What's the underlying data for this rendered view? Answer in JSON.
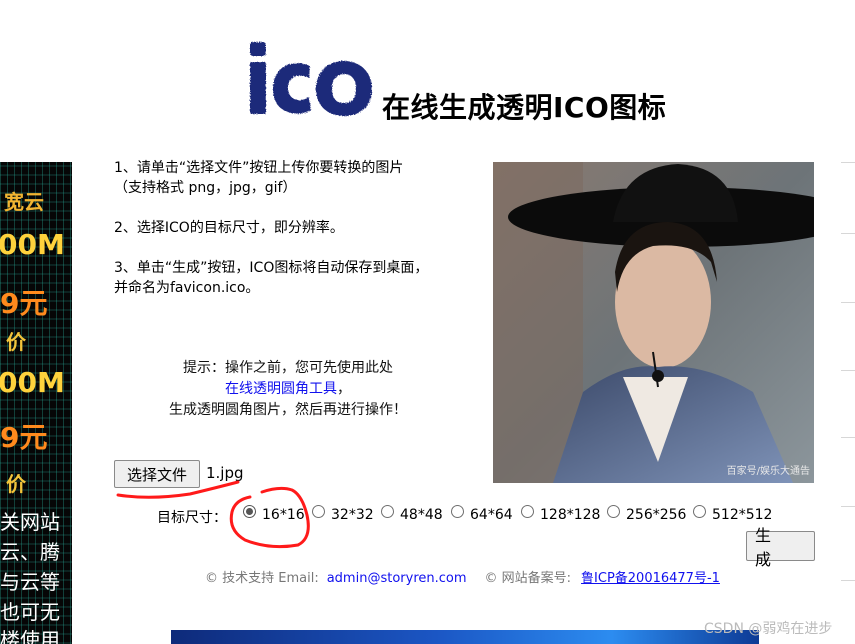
{
  "header": {
    "logo_text": "ico",
    "title": "在线生成透明ICO图标"
  },
  "ad": {
    "lines": [
      "宽云",
      "00M",
      "9元",
      "价",
      "00M",
      "9元",
      "价",
      "关网站",
      "云、腾",
      "与云等",
      "也可无",
      "楼使用"
    ]
  },
  "steps": {
    "step1_line1": "1、请单击“选择文件”按钮上传你要转换的图片",
    "step1_line2": "（支持格式 png，jpg，gif）",
    "step2": "2、选择ICO的目标尺寸，即分辨率。",
    "step3_line1": "3、单击“生成”按钮，ICO图标将自动保存到桌面，",
    "step3_line2": "并命名为favicon.ico。"
  },
  "tip": {
    "line1": "提示：操作之前，您可先使用此处",
    "link": "在线透明圆角工具",
    "link_suffix": "，",
    "line3": "生成透明圆角图片，然后再进行操作！"
  },
  "preview": {
    "caption": "百家号/娱乐大通告"
  },
  "form": {
    "file_button": "选择文件",
    "file_name": "1.jpg",
    "size_label": "目标尺寸：",
    "sizes": [
      "16*16",
      "32*32",
      "48*48",
      "64*64",
      "128*128",
      "256*256",
      "512*512"
    ],
    "selected_size": "16*16",
    "generate_button": "生 成"
  },
  "footer": {
    "support_label": "© 技术支持 Email:",
    "email": "admin@storyren.com",
    "icp_label": "© 网站备案号:",
    "icp": "鲁ICP备20016477号-1"
  },
  "watermark": "CSDN @弱鸡在进步",
  "colors": {
    "link": "#1111ee",
    "annotation": "#ff1a1a",
    "logo": "#1f2a7a"
  }
}
